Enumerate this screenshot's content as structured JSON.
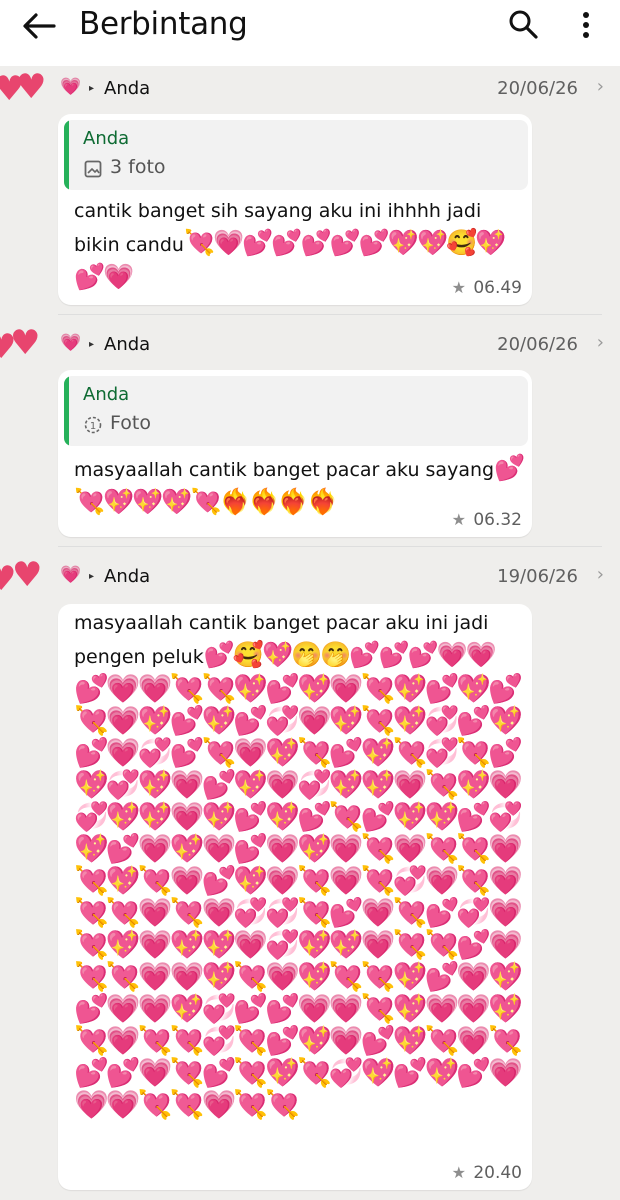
{
  "app": {
    "title": "Berbintang",
    "back_icon": "arrow-left-icon",
    "search_icon": "search-icon",
    "more_icon": "more-vertical-icon"
  },
  "messages": [
    {
      "sender": "Anda",
      "date": "20/06/26",
      "quote": {
        "name": "Anda",
        "text": "3 foto",
        "icon": "image-icon"
      },
      "text": "cantik banget sih sayang aku ini ihhhh jadi bikin candu",
      "emoji": "💘💗💕💕💕💕💕💖💖🥰💖💕💗",
      "time": "06.49"
    },
    {
      "sender": "Anda",
      "date": "20/06/26",
      "quote": {
        "name": "Anda",
        "text": "Foto",
        "icon": "view-once-icon"
      },
      "text": "masyaallah cantik banget pacar aku sayang",
      "emoji": "💕💘💖💖💖💘❤️‍🔥❤️‍🔥❤️‍🔥❤️‍🔥",
      "time": "06.32"
    },
    {
      "sender": "Anda",
      "date": "19/06/26",
      "text": "masyaallah cantik banget pacar aku ini jadi pengen peluk",
      "emoji": "💕🥰💖🤭🤭💕💕💕💗💗",
      "hearts": "💕💗💗💘💘💖💕💖💗💘💖💕💖💕💘💗💖💕💖💕💞💗💖💘💖💞💕💖💕💗💞💕💘💗💖💘💕💖💘💞💘💕💖💞💖💗💕💖💗💞💖💖💗💘💖💗💞💖💖💗💖💕💖💕💘💕💖💖💕💞💖💕💗💖💗💕💗💖💗💘💗💘💘💗💘💖💘💗💕💖💗💘💗💘💞💗💘💗💘💘💗💘💗💞💞💘💕💗💘💕💞💗💘💖💗💖💖💗💞💖💖💗💘💘💕💗💘💘💗💗💖💘💗💖💘💘💖💕💗💖💕💗💗💖💞💕💕💗💗💘💖💗💗💖💘💗💘💘💞💘💕💖💗💕💖💘💗💘💕💕💗💘💕💘💖💘💞💖💕💖💕💗💗💗💘💘💗💘💘",
      "time": "20.40"
    }
  ]
}
